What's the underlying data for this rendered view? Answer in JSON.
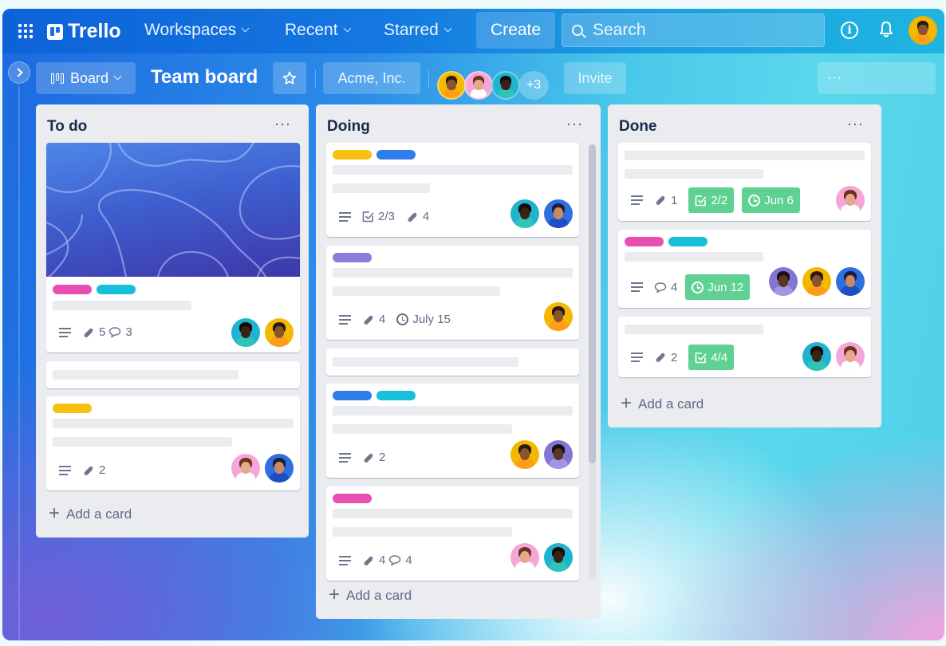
{
  "nav": {
    "app_name": "Trello",
    "menus": [
      {
        "label": "Workspaces"
      },
      {
        "label": "Recent"
      },
      {
        "label": "Starred"
      }
    ],
    "create_label": "Create",
    "search_placeholder": "Search",
    "info_symbol": "i"
  },
  "board": {
    "view_label": "Board",
    "title": "Team board",
    "workspace_label": "Acme, Inc.",
    "extra_members": "+3",
    "invite_label": "Invite",
    "menu_label": "···"
  },
  "avatars": {
    "yellow_woman": {
      "bg": "#f5b800",
      "skin": "#8a5430",
      "hair": "#2a1a14",
      "shirt": "#ff9d1b"
    },
    "pink_man": {
      "bg": "#f6a6d6",
      "skin": "#e5a889",
      "hair": "#6b3320",
      "shirt": "#ffffff"
    },
    "teal_woman": {
      "bg": "#1fb3cf",
      "skin": "#3b2314",
      "hair": "#120b08",
      "shirt": "#2ec4b8"
    },
    "blue_man": {
      "bg": "#2f6fe0",
      "skin": "#c98a63",
      "hair": "#1d1f3a",
      "shirt": "#1e4fc2"
    },
    "purple_man": {
      "bg": "#8474d3",
      "skin": "#5a3620",
      "hair": "#1a1010",
      "shirt": "#a494e2"
    }
  },
  "label_colors": {
    "pink": "#e94fb3",
    "teal": "#17c0d8",
    "yellow": "#f6c10f",
    "blue": "#2e7de8",
    "purple": "#8b7cd8"
  },
  "lists": [
    {
      "title": "To do",
      "menu": "···",
      "add_card_label": "Add a card",
      "cards": [
        {
          "cover": true,
          "labels": [
            "pink",
            "teal"
          ],
          "attachments": "5",
          "comments": "3",
          "members": [
            "teal_woman",
            "yellow_woman"
          ]
        },
        {
          "labels": []
        },
        {
          "labels": [
            "yellow"
          ],
          "attachments": "2",
          "members": [
            "pink_man",
            "blue_man"
          ]
        }
      ]
    },
    {
      "title": "Doing",
      "menu": "···",
      "add_card_label": "Add a card",
      "cards": [
        {
          "labels": [
            "yellow",
            "blue"
          ],
          "checklist": "2/3",
          "attachments": "4",
          "members": [
            "teal_woman",
            "blue_man"
          ]
        },
        {
          "labels": [
            "purple"
          ],
          "attachments": "4",
          "due": "July 15",
          "members": [
            "yellow_woman"
          ]
        },
        {
          "labels": []
        },
        {
          "labels": [
            "blue",
            "teal"
          ],
          "attachments": "2",
          "members": [
            "yellow_woman",
            "purple_man"
          ]
        },
        {
          "labels": [
            "pink"
          ],
          "attachments": "4",
          "comments": "4",
          "members": [
            "pink_man",
            "teal_woman"
          ]
        }
      ]
    },
    {
      "title": "Done",
      "menu": "···",
      "add_card_label": "Add a card",
      "cards": [
        {
          "labels": [],
          "attachments": "1",
          "checklist": "2/2",
          "due": "Jun 6",
          "members": [
            "pink_man"
          ]
        },
        {
          "labels": [
            "pink",
            "teal"
          ],
          "comments": "4",
          "due": "Jun 12",
          "members": [
            "purple_man",
            "yellow_woman",
            "blue_man"
          ]
        },
        {
          "labels": [],
          "attachments": "2",
          "checklist": "4/4",
          "members": [
            "teal_woman",
            "pink_man"
          ]
        }
      ]
    }
  ]
}
